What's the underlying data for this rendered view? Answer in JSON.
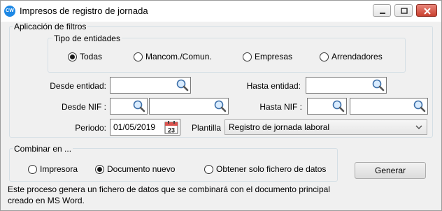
{
  "window": {
    "title": "Impresos de registro de jornada",
    "app_icon_text": "CW",
    "minimize_icon": "minimize-icon",
    "maximize_icon": "maximize-icon",
    "close_icon": "close-icon"
  },
  "filters": {
    "group_title": "Aplicación de filtros",
    "entity_type": {
      "group_title": "Tipo de entidades",
      "options": [
        {
          "label": "Todas",
          "checked": true
        },
        {
          "label": "Mancom./Comun.",
          "checked": false
        },
        {
          "label": "Empresas",
          "checked": false
        },
        {
          "label": "Arrendadores",
          "checked": false
        }
      ]
    },
    "from_entity_label": "Desde entidad:",
    "from_entity_value": "",
    "to_entity_label": "Hasta entidad:",
    "to_entity_value": "",
    "from_nif_label": "Desde NIF :",
    "from_nif_value_1": "",
    "from_nif_value_2": "",
    "to_nif_label": "Hasta NIF :",
    "to_nif_value_1": "",
    "to_nif_value_2": "",
    "period_label": "Periodo:",
    "period_value": "01/05/2019",
    "calendar_day": "23",
    "template_label": "Plantilla",
    "template_value": "Registro de jornada laboral"
  },
  "combine": {
    "group_title": "Combinar en ...",
    "options": [
      {
        "label": "Impresora",
        "checked": false
      },
      {
        "label": "Documento nuevo",
        "checked": true
      },
      {
        "label": "Obtener solo fichero de datos",
        "checked": false
      }
    ]
  },
  "generate_label": "Generar",
  "info_line_1": "Este proceso genera un fichero de datos que se combinará con el documento principal",
  "info_line_2": "creado en MS Word.",
  "colors": {
    "close_button": "#c9402f",
    "app_icon": "#1e88e5"
  }
}
